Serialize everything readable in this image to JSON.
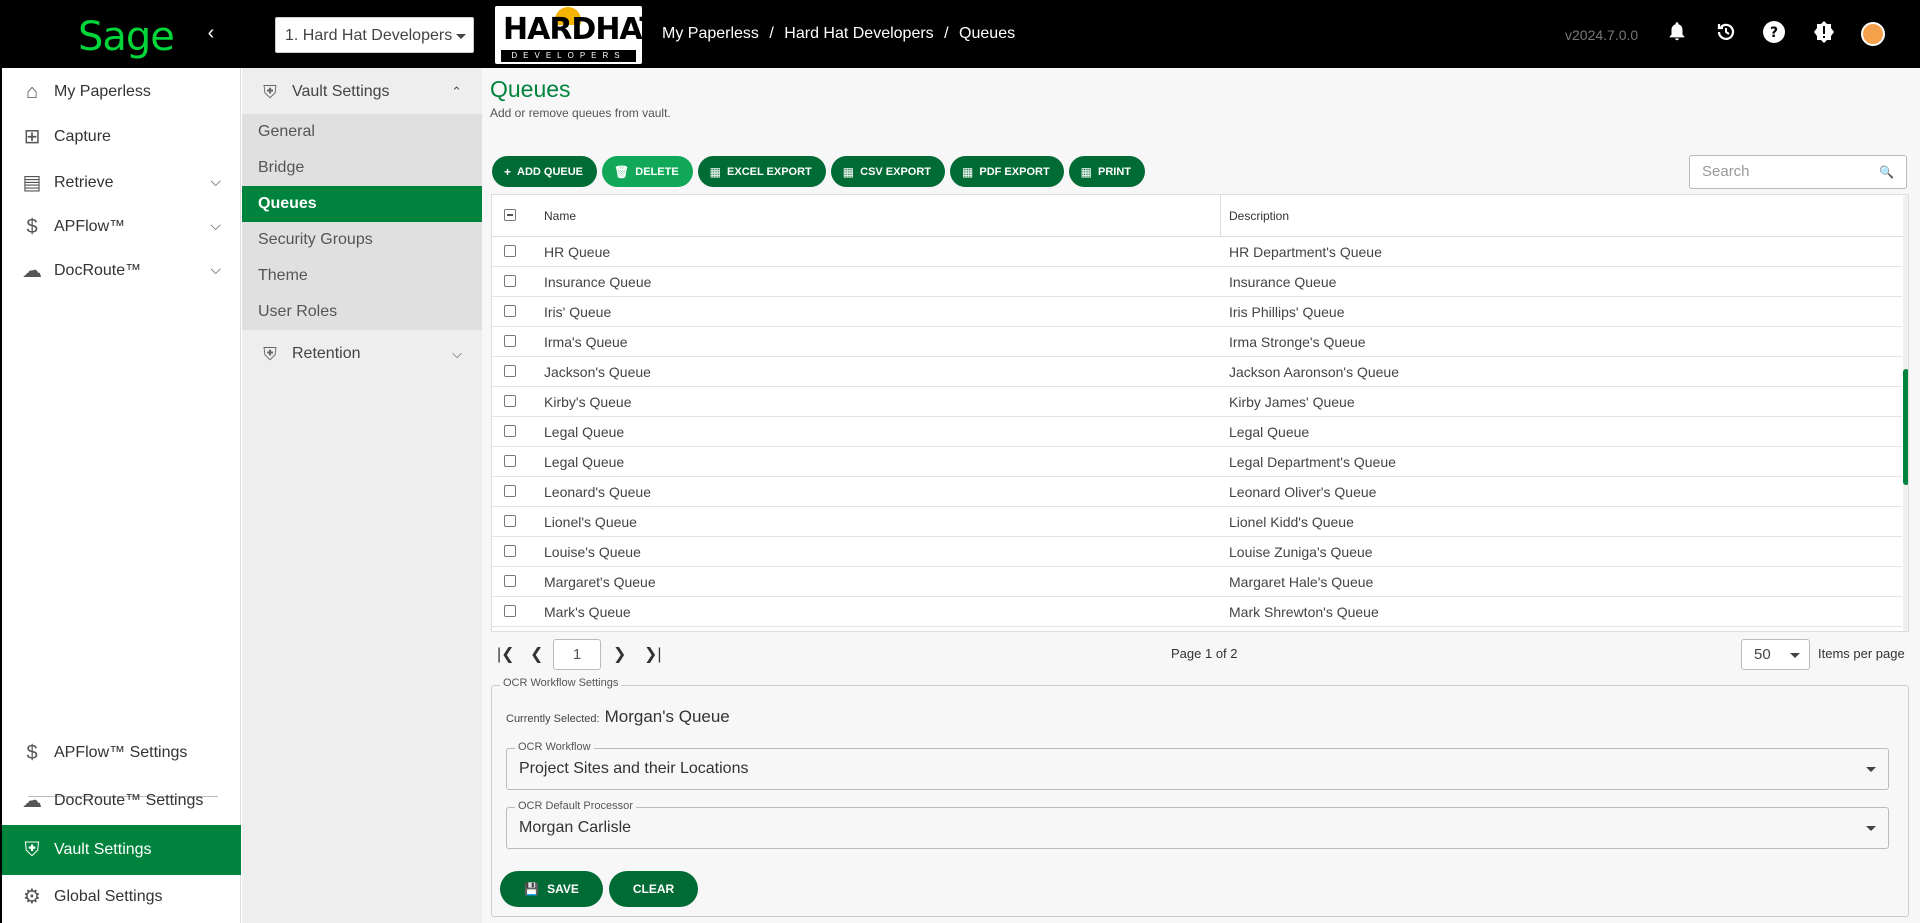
{
  "topbar": {
    "logo": "Sage",
    "vault_selected": "1. Hard Hat Developers",
    "company_logo_title": "HARDHAT",
    "company_logo_sub": "DEVELOPERS",
    "breadcrumb": [
      "My Paperless",
      "/",
      "Hard Hat Developers",
      "/",
      "Queues"
    ],
    "version": "v2024.7.0.0"
  },
  "leftnav": {
    "items": [
      {
        "label": "My Paperless"
      },
      {
        "label": "Capture"
      },
      {
        "label": "Retrieve"
      },
      {
        "label": "APFlow™"
      },
      {
        "label": "DocRoute™"
      }
    ],
    "settings": [
      {
        "label": "APFlow™ Settings"
      },
      {
        "label": "DocRoute™ Settings"
      },
      {
        "label": "Vault Settings"
      },
      {
        "label": "Global Settings"
      }
    ]
  },
  "submenu": {
    "section": "Vault Settings",
    "items": [
      "General",
      "Bridge",
      "Queues",
      "Security Groups",
      "Theme",
      "User Roles"
    ],
    "section2": "Retention"
  },
  "main": {
    "title": "Queues",
    "subtitle": "Add or remove queues from vault.",
    "toolbar": {
      "add": "ADD QUEUE",
      "delete": "DELETE",
      "excel": "EXCEL EXPORT",
      "csv": "CSV EXPORT",
      "pdf": "PDF EXPORT",
      "print": "PRINT"
    },
    "search_placeholder": "Search",
    "columns": [
      "Name",
      "Description"
    ],
    "rows": [
      [
        "HR Queue",
        "HR Department's Queue"
      ],
      [
        "Insurance Queue",
        "Insurance Queue"
      ],
      [
        "Iris' Queue",
        "Iris Phillips' Queue"
      ],
      [
        "Irma's Queue",
        "Irma Stronge's Queue"
      ],
      [
        "Jackson's Queue",
        "Jackson Aaronson's Queue"
      ],
      [
        "Kirby's Queue",
        "Kirby James' Queue"
      ],
      [
        "Legal Queue",
        "Legal Queue"
      ],
      [
        "Legal Queue",
        "Legal Department's Queue"
      ],
      [
        "Leonard's Queue",
        "Leonard Oliver's Queue"
      ],
      [
        "Lionel's Queue",
        "Lionel Kidd's Queue"
      ],
      [
        "Louise's Queue",
        "Louise Zuniga's Queue"
      ],
      [
        "Margaret's Queue",
        "Margaret Hale's Queue"
      ],
      [
        "Mark's Queue",
        "Mark Shrewton's Queue"
      ]
    ],
    "pager": {
      "page": "1",
      "info": "Page 1 of 2",
      "page_size": "50",
      "page_size_label": "Items per page"
    },
    "ocr": {
      "legend": "OCR Workflow Settings",
      "current_label": "Currently Selected:",
      "current_value": "Morgan's Queue",
      "workflow_label": "OCR Workflow",
      "workflow_value": "Project Sites and their Locations",
      "processor_label": "OCR Default Processor",
      "processor_value": "Morgan Carlisle",
      "save": "SAVE",
      "clear": "CLEAR"
    }
  },
  "colors": {
    "accent": "#00843d",
    "accent_dark": "#006b35",
    "topbar": "#000000"
  }
}
